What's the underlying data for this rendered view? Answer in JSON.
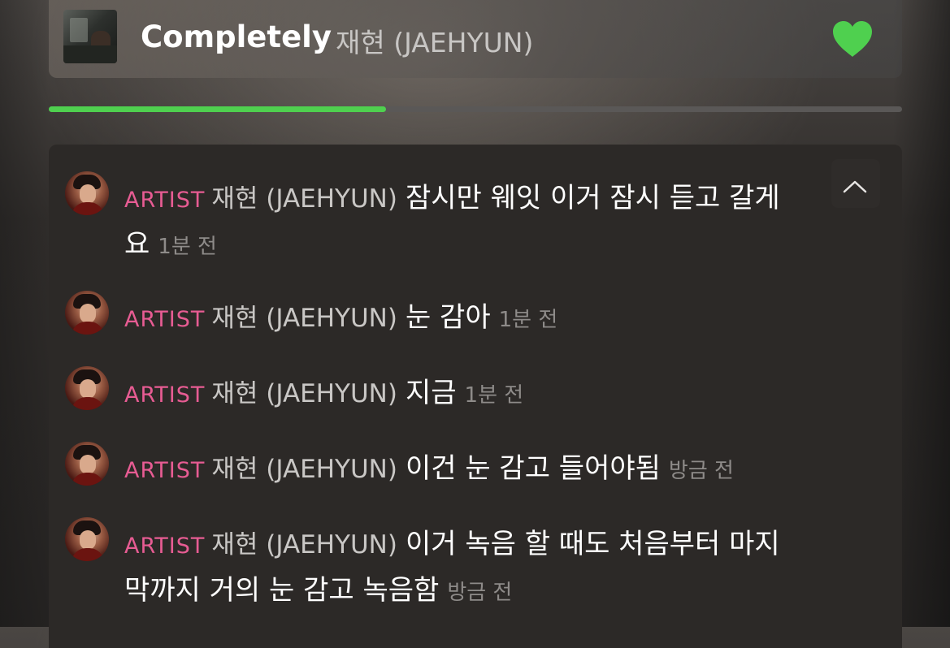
{
  "now_playing": {
    "title": "Completely",
    "artist": "재현 (JAEHYUN)",
    "liked": true,
    "heart_color": "#4fd04f",
    "album_art": "album-cover"
  },
  "playback": {
    "progress_percent": 39.5,
    "progress_color": "#4fd04f"
  },
  "comments_panel": {
    "collapse_icon": "chevron-up-icon",
    "comments": [
      {
        "role": "ARTIST",
        "author": "재현 (JAEHYUN)",
        "message": "잠시만 웨잇 이거 잠시 듣고 갈게요",
        "time": "1분 전",
        "avatar": "artist-avatar"
      },
      {
        "role": "ARTIST",
        "author": "재현 (JAEHYUN)",
        "message": "눈 감아",
        "time": "1분 전",
        "avatar": "artist-avatar"
      },
      {
        "role": "ARTIST",
        "author": "재현 (JAEHYUN)",
        "message": "지금",
        "time": "1분 전",
        "avatar": "artist-avatar"
      },
      {
        "role": "ARTIST",
        "author": "재현 (JAEHYUN)",
        "message": "이건 눈 감고 들어야됨",
        "time": "방금 전",
        "avatar": "artist-avatar"
      },
      {
        "role": "ARTIST",
        "author": "재현 (JAEHYUN)",
        "message": "이거 녹음 할 때도 처음부터 마지막까지 거의 눈 감고 녹음함",
        "time": "방금 전",
        "avatar": "artist-avatar"
      }
    ]
  },
  "colors": {
    "role_badge": "#e75c93",
    "author_text": "#c9c7c5",
    "timestamp_text": "#8e8b89",
    "panel_background": "#2c2927"
  }
}
